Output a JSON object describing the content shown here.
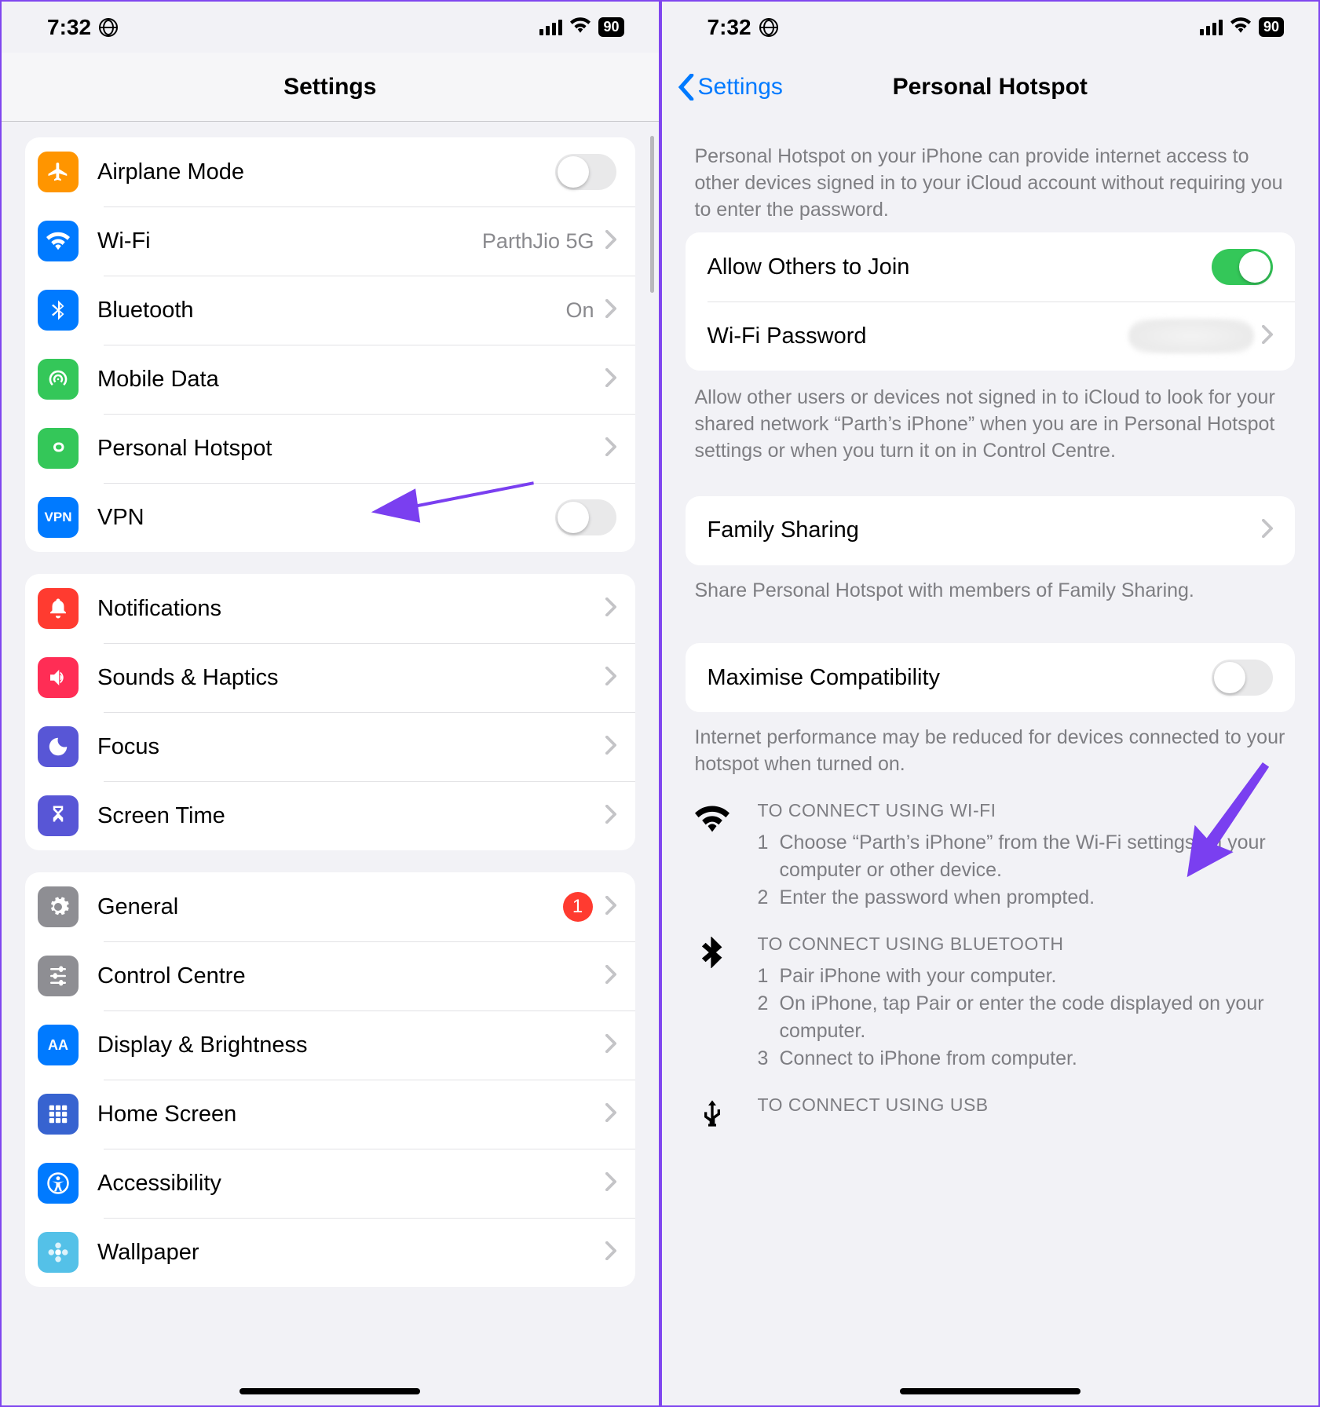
{
  "status": {
    "time": "7:32",
    "battery": "90"
  },
  "left": {
    "title": "Settings",
    "g1": {
      "airplane": "Airplane Mode",
      "wifi": "Wi-Fi",
      "wifi_val": "ParthJio 5G",
      "bt": "Bluetooth",
      "bt_val": "On",
      "mobile": "Mobile Data",
      "hotspot": "Personal Hotspot",
      "vpn": "VPN"
    },
    "g2": {
      "notif": "Notifications",
      "sounds": "Sounds & Haptics",
      "focus": "Focus",
      "screentime": "Screen Time"
    },
    "g3": {
      "general": "General",
      "general_badge": "1",
      "cc": "Control Centre",
      "display": "Display & Brightness",
      "home": "Home Screen",
      "access": "Accessibility",
      "wallpaper": "Wallpaper"
    }
  },
  "right": {
    "back": "Settings",
    "title": "Personal Hotspot",
    "intro": "Personal Hotspot on your iPhone can provide internet access to other devices signed in to your iCloud account without requiring you to enter the password.",
    "allow": "Allow Others to Join",
    "wifipw": "Wi-Fi Password",
    "allow_desc": "Allow other users or devices not signed in to iCloud to look for your shared network “Parth’s iPhone” when you are in Personal Hotspot settings or when you turn it on in Control Centre.",
    "family": "Family Sharing",
    "family_desc": "Share Personal Hotspot with members of Family Sharing.",
    "maxcompat": "Maximise Compatibility",
    "maxcompat_desc": "Internet performance may be reduced for devices connected to your hotspot when turned on.",
    "wifi_title": "TO CONNECT USING WI-FI",
    "wifi_s1n": "1",
    "wifi_s1": "Choose “Parth’s iPhone” from the Wi-Fi settings on your computer or other device.",
    "wifi_s2n": "2",
    "wifi_s2": "Enter the password when prompted.",
    "bt_title": "TO CONNECT USING BLUETOOTH",
    "bt_s1n": "1",
    "bt_s1": "Pair iPhone with your computer.",
    "bt_s2n": "2",
    "bt_s2": "On iPhone, tap Pair or enter the code displayed on your computer.",
    "bt_s3n": "3",
    "bt_s3": "Connect to iPhone from computer.",
    "usb_title": "TO CONNECT USING USB"
  }
}
